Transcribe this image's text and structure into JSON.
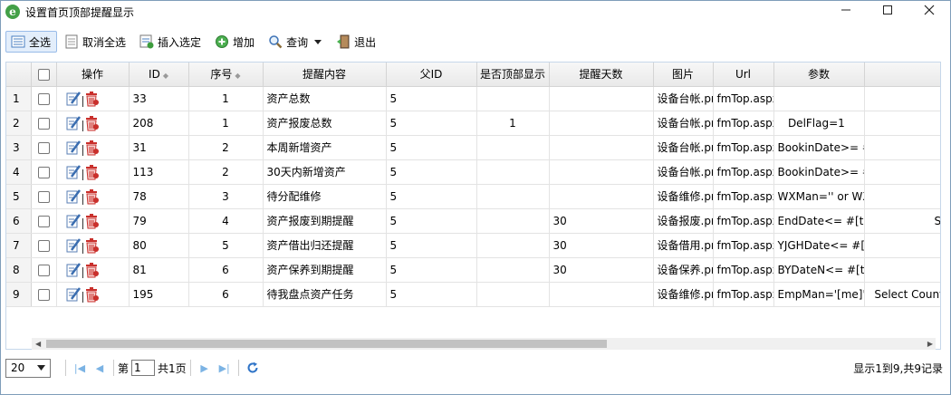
{
  "window": {
    "title": "设置首页顶部提醒显示",
    "minimize_icon": "minimize-icon",
    "maximize_icon": "maximize-icon",
    "close_icon": "close-icon"
  },
  "toolbar": {
    "select_all": "全选",
    "deselect_all": "取消全选",
    "insert_selected": "插入选定",
    "add": "增加",
    "query": "查询",
    "exit": "退出"
  },
  "grid": {
    "columns": [
      "操作",
      "ID",
      "序号",
      "提醒内容",
      "父ID",
      "是否顶部显示",
      "提醒天数",
      "图片",
      "Url",
      "参数"
    ],
    "rows": [
      {
        "rn": "1",
        "id": "33",
        "seq": "1",
        "content": "资产总数",
        "pid": "5",
        "top": "",
        "days": "",
        "img": "设备台帐.png",
        "url": "fmTop.aspx",
        "param": "",
        "extra": ""
      },
      {
        "rn": "2",
        "id": "208",
        "seq": "1",
        "content": "资产报废总数",
        "pid": "5",
        "top": "1",
        "days": "",
        "img": "设备台帐.png",
        "url": "fmTop.aspx",
        "param": "   DelFlag=1",
        "extra": ""
      },
      {
        "rn": "3",
        "id": "31",
        "seq": "2",
        "content": "本周新增资产",
        "pid": "5",
        "top": "",
        "days": "",
        "img": "设备台帐.png",
        "url": "fmTop.aspx",
        "param": "BookinDate>= #",
        "extra": ""
      },
      {
        "rn": "4",
        "id": "113",
        "seq": "2",
        "content": "30天内新增资产",
        "pid": "5",
        "top": "",
        "days": "",
        "img": "设备台帐.png",
        "url": "fmTop.aspx",
        "param": "BookinDate>= #",
        "extra": ""
      },
      {
        "rn": "5",
        "id": "78",
        "seq": "3",
        "content": "待分配维修",
        "pid": "5",
        "top": "",
        "days": "",
        "img": "设备维修.png",
        "url": "fmTop.aspx",
        "param": "WXMan='' or WX",
        "extra": ""
      },
      {
        "rn": "6",
        "id": "79",
        "seq": "4",
        "content": "资产报废到期提醒",
        "pid": "5",
        "top": "",
        "days": "30",
        "img": "设备报废.png",
        "url": "fmTop.aspx",
        "param": "EndDate<= #[to",
        "extra": "Se"
      },
      {
        "rn": "7",
        "id": "80",
        "seq": "5",
        "content": "资产借出归还提醒",
        "pid": "5",
        "top": "",
        "days": "30",
        "img": "设备借用.png",
        "url": "fmTop.aspx",
        "param": "YJGHDate<= #[",
        "extra": ""
      },
      {
        "rn": "8",
        "id": "81",
        "seq": "6",
        "content": "资产保养到期提醒",
        "pid": "5",
        "top": "",
        "days": "30",
        "img": "设备保养.png",
        "url": "fmTop.aspx",
        "param": "BYDateN<= #[to",
        "extra": ""
      },
      {
        "rn": "9",
        "id": "195",
        "seq": "6",
        "content": "待我盘点资产任务",
        "pid": "5",
        "top": "",
        "days": "",
        "img": "设备维修.png",
        "url": "fmTop.aspx",
        "param": "EmpMan='[me]'",
        "extra": "Select Count("
      }
    ]
  },
  "pager": {
    "page_size": "20",
    "page_label": "第",
    "page_value": "1",
    "total_pages": "共1页",
    "info": "显示1到9,共9记录"
  }
}
